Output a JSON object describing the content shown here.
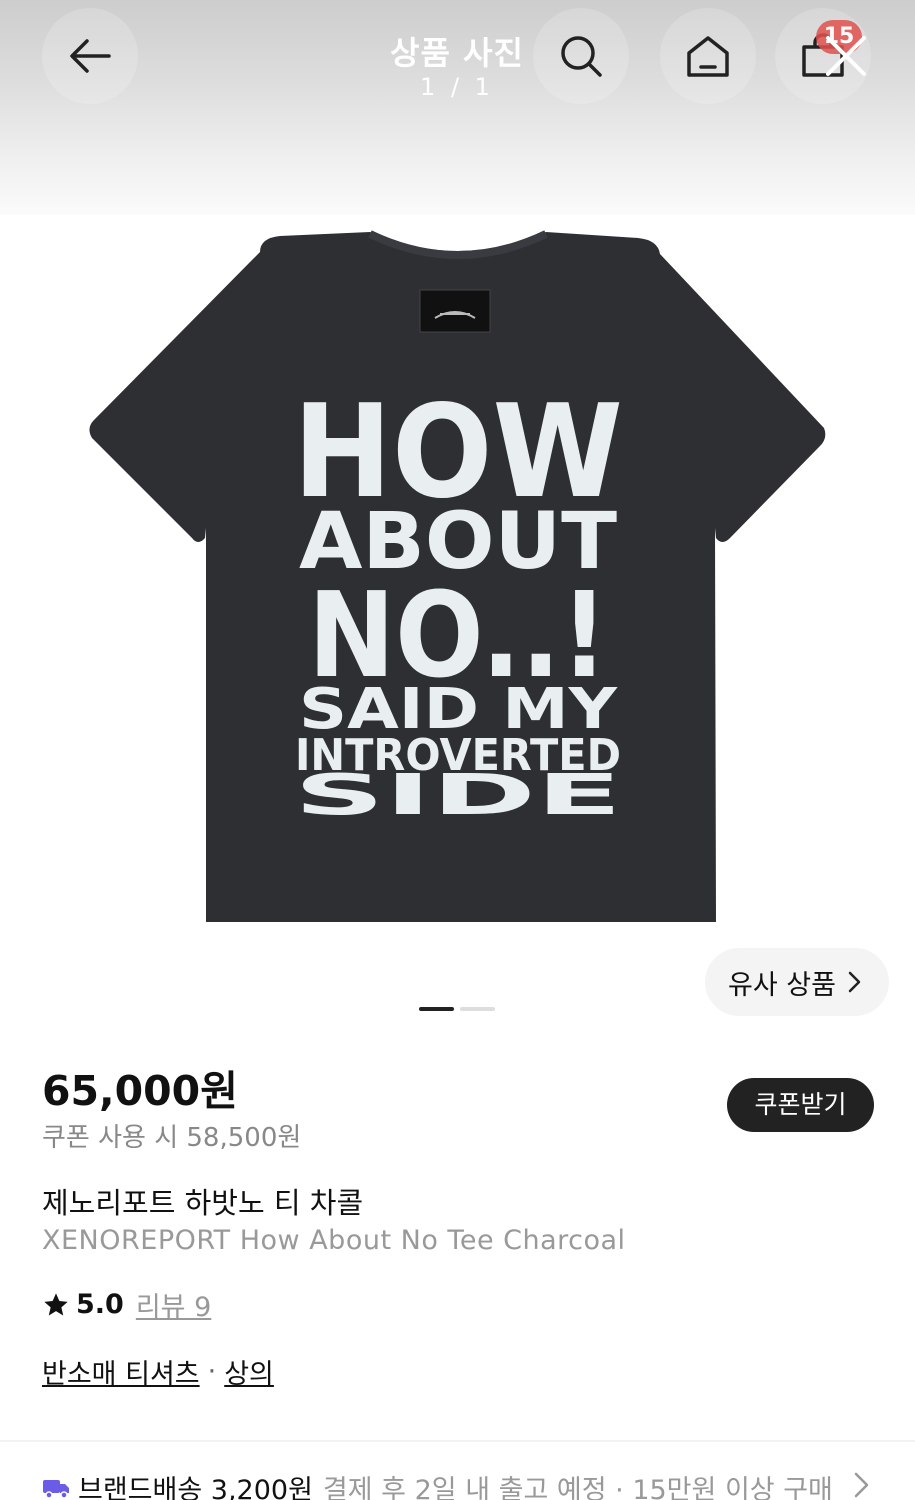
{
  "viewer": {
    "title": "상품 사진",
    "count": "1 / 1",
    "cart_count": "15"
  },
  "icons": {
    "back": "arrow-left-icon",
    "search": "search-icon",
    "home": "home-icon",
    "cart": "cart-icon",
    "close": "close-icon",
    "star": "star-icon",
    "truck": "truck-icon",
    "chevron": "chevron-right-icon"
  },
  "product_image": {
    "print_lines": [
      "HOW",
      "ABOUT",
      "NO..!",
      "SAID MY",
      "INTROVERTED",
      "SIDE"
    ],
    "shirt_color": "#2e2f33",
    "print_color": "#e9eef0"
  },
  "gallery": {
    "similar_label": "유사 상품",
    "dots": 2,
    "active_dot": 0
  },
  "price": {
    "current": "65,000원",
    "coupon": "쿠폰 사용 시 58,500원",
    "coupon_button": "쿠폰받기"
  },
  "product": {
    "name_ko": "제노리포트 하밧노 티 차콜",
    "name_en": "XENOREPORT How About No Tee Charcoal",
    "rating": "5.0",
    "review": "리뷰 9",
    "category": [
      "반소매 티셔츠",
      "상의"
    ],
    "category_sep": "·"
  },
  "shipping": {
    "label": "브랜드배송 3,200원",
    "detail": "결제 후 2일 내 출고 예정 · 15만원 이상 구매"
  },
  "colors": {
    "badge": "#e0524f",
    "truck": "#6b5ce7",
    "dark_button": "#222222"
  }
}
